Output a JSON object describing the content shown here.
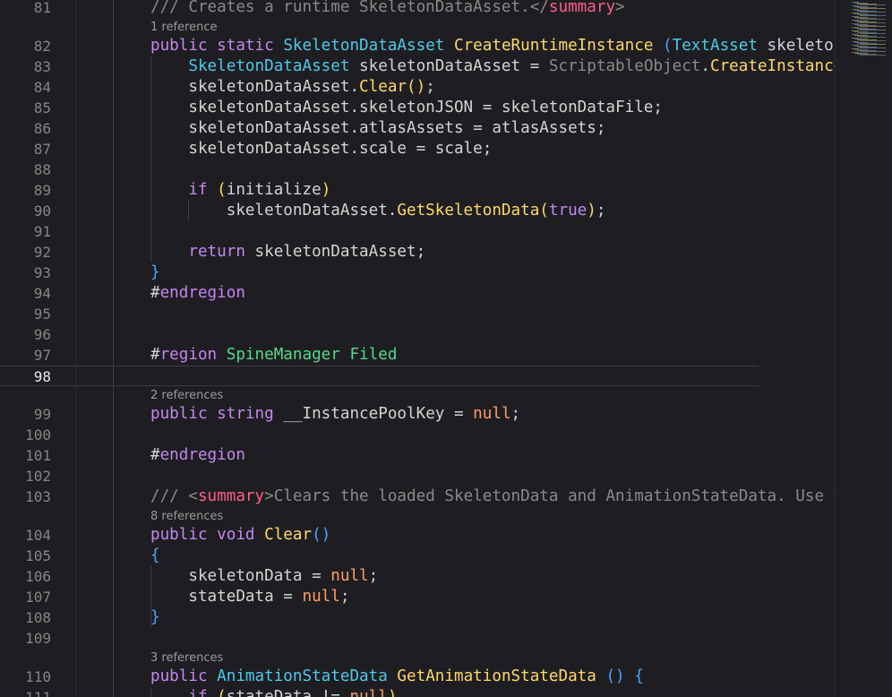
{
  "lines": [
    {
      "n": "81",
      "lens": null,
      "tokens": [
        [
          "c",
          "/// Creates a runtime SkeletonDataAsset.</"
        ],
        [
          "ct",
          "summary"
        ],
        [
          "c",
          ">"
        ]
      ]
    },
    {
      "n": "82",
      "lens": "1 reference",
      "tokens": [
        [
          "k",
          "public"
        ],
        [
          "p",
          " "
        ],
        [
          "k",
          "static"
        ],
        [
          "p",
          " "
        ],
        [
          "t",
          "SkeletonDataAsset"
        ],
        [
          "p",
          " "
        ],
        [
          "m",
          "CreateRuntimeInstance"
        ],
        [
          "p",
          " "
        ],
        [
          "b",
          "("
        ],
        [
          "t",
          "TextAsset"
        ],
        [
          "p",
          " skeleton"
        ]
      ]
    },
    {
      "n": "83",
      "lens": null,
      "tokens": [
        [
          "p",
          "    "
        ],
        [
          "t",
          "SkeletonDataAsset"
        ],
        [
          "p",
          " skeletonDataAsset = "
        ],
        [
          "so",
          "ScriptableObject"
        ],
        [
          "p",
          "."
        ],
        [
          "m",
          "CreateInstance"
        ]
      ]
    },
    {
      "n": "84",
      "lens": null,
      "tokens": [
        [
          "p",
          "    skeletonDataAsset."
        ],
        [
          "m",
          "Clear"
        ],
        [
          "y",
          "()"
        ],
        [
          "p",
          ";"
        ]
      ]
    },
    {
      "n": "85",
      "lens": null,
      "tokens": [
        [
          "p",
          "    skeletonDataAsset.skeletonJSON = skeletonDataFile;"
        ]
      ]
    },
    {
      "n": "86",
      "lens": null,
      "tokens": [
        [
          "p",
          "    skeletonDataAsset.atlasAssets = atlasAssets;"
        ]
      ]
    },
    {
      "n": "87",
      "lens": null,
      "tokens": [
        [
          "p",
          "    skeletonDataAsset.scale = scale;"
        ]
      ]
    },
    {
      "n": "88",
      "lens": null,
      "tokens": []
    },
    {
      "n": "89",
      "lens": null,
      "tokens": [
        [
          "p",
          "    "
        ],
        [
          "k",
          "if"
        ],
        [
          "p",
          " "
        ],
        [
          "y",
          "("
        ],
        [
          "p",
          "initialize"
        ],
        [
          "y",
          ")"
        ]
      ]
    },
    {
      "n": "90",
      "lens": null,
      "tokens": [
        [
          "p",
          "        skeletonDataAsset."
        ],
        [
          "m",
          "GetSkeletonData"
        ],
        [
          "y",
          "("
        ],
        [
          "k",
          "true"
        ],
        [
          "y",
          ")"
        ],
        [
          "p",
          ";"
        ]
      ]
    },
    {
      "n": "91",
      "lens": null,
      "tokens": []
    },
    {
      "n": "92",
      "lens": null,
      "tokens": [
        [
          "p",
          "    "
        ],
        [
          "k",
          "return"
        ],
        [
          "p",
          " skeletonDataAsset;"
        ]
      ]
    },
    {
      "n": "93",
      "lens": null,
      "tokens": [
        [
          "b",
          "}"
        ]
      ]
    },
    {
      "n": "94",
      "lens": null,
      "tokens": [
        [
          "p",
          "#"
        ],
        [
          "pp",
          "endregion"
        ]
      ]
    },
    {
      "n": "95",
      "lens": null,
      "tokens": []
    },
    {
      "n": "96",
      "lens": null,
      "tokens": []
    },
    {
      "n": "97",
      "lens": null,
      "tokens": [
        [
          "p",
          "#"
        ],
        [
          "pp",
          "region"
        ],
        [
          "p",
          " "
        ],
        [
          "rg",
          "SpineManager Filed"
        ]
      ]
    },
    {
      "n": "98",
      "lens": null,
      "tokens": []
    },
    {
      "n": "99",
      "lens": "2 references",
      "tokens": [
        [
          "k",
          "public"
        ],
        [
          "p",
          " "
        ],
        [
          "k",
          "string"
        ],
        [
          "p",
          " __InstancePoolKey = "
        ],
        [
          "n",
          "null"
        ],
        [
          "p",
          ";"
        ]
      ]
    },
    {
      "n": "100",
      "lens": null,
      "tokens": []
    },
    {
      "n": "101",
      "lens": null,
      "tokens": [
        [
          "p",
          "#"
        ],
        [
          "pp",
          "endregion"
        ]
      ]
    },
    {
      "n": "102",
      "lens": null,
      "tokens": []
    },
    {
      "n": "103",
      "lens": null,
      "tokens": [
        [
          "c",
          "/// <"
        ],
        [
          "ct",
          "summary"
        ],
        [
          "c",
          ">Clears the loaded SkeletonData and AnimationStateData. Use t"
        ]
      ]
    },
    {
      "n": "104",
      "lens": "8 references",
      "tokens": [
        [
          "k",
          "public"
        ],
        [
          "p",
          " "
        ],
        [
          "k",
          "void"
        ],
        [
          "p",
          " "
        ],
        [
          "m",
          "Clear"
        ],
        [
          "b",
          "()"
        ]
      ]
    },
    {
      "n": "105",
      "lens": null,
      "tokens": [
        [
          "b",
          "{"
        ]
      ]
    },
    {
      "n": "106",
      "lens": null,
      "tokens": [
        [
          "p",
          "    skeletonData = "
        ],
        [
          "n",
          "null"
        ],
        [
          "p",
          ";"
        ]
      ]
    },
    {
      "n": "107",
      "lens": null,
      "tokens": [
        [
          "p",
          "    stateData = "
        ],
        [
          "n",
          "null"
        ],
        [
          "p",
          ";"
        ]
      ]
    },
    {
      "n": "108",
      "lens": null,
      "tokens": [
        [
          "b",
          "}"
        ]
      ]
    },
    {
      "n": "109",
      "lens": null,
      "tokens": []
    },
    {
      "n": "110",
      "lens": "3 references",
      "tokens": [
        [
          "k",
          "public"
        ],
        [
          "p",
          " "
        ],
        [
          "t",
          "AnimationStateData"
        ],
        [
          "p",
          " "
        ],
        [
          "m",
          "GetAnimationStateData"
        ],
        [
          "p",
          " "
        ],
        [
          "b",
          "()"
        ],
        [
          "p",
          " "
        ],
        [
          "b",
          "{"
        ]
      ]
    },
    {
      "n": "111",
      "lens": null,
      "tokens": [
        [
          "p",
          "    "
        ],
        [
          "k",
          "if"
        ],
        [
          "p",
          " "
        ],
        [
          "y",
          "("
        ],
        [
          "p",
          "stateData != "
        ],
        [
          "n",
          "null"
        ],
        [
          "y",
          ")"
        ]
      ]
    }
  ],
  "active_line": "98",
  "colors": {
    "background": "#1e1e22",
    "keyword": "#c586f0",
    "type": "#4ec9e9",
    "method": "#ffd866",
    "comment": "#8a8a8a",
    "region": "#57d98a"
  }
}
